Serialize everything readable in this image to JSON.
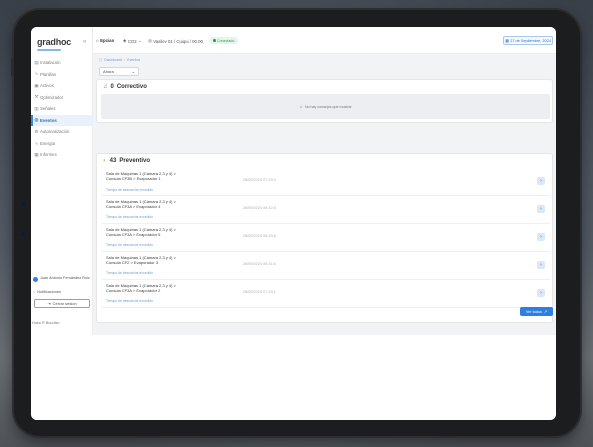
{
  "app": {
    "logo_text": "gradhoc",
    "topbar": {
      "project": "Epcian",
      "site": "CO2",
      "address": "Vasilev 01 / Cuiqui / 00.00",
      "status": "Conectado",
      "date": "27 de Septiembre, 2024"
    },
    "sidebar": {
      "items": [
        {
          "label": "Instalación",
          "icon": "chart-icon",
          "active": false
        },
        {
          "label": "Planillas",
          "icon": "pulse-icon",
          "active": false
        },
        {
          "label": "Activos",
          "icon": "box-icon",
          "active": false
        },
        {
          "label": "Optimizador",
          "icon": "wrench-icon",
          "active": false
        },
        {
          "label": "Señales",
          "icon": "signal-icon",
          "active": false
        },
        {
          "label": "Eventos",
          "icon": "alert-icon",
          "active": true
        },
        {
          "label": "Automatización",
          "icon": "gear-icon",
          "active": false
        },
        {
          "label": "Energía",
          "icon": "bolt-icon",
          "active": false
        },
        {
          "label": "Informes",
          "icon": "doc-icon",
          "active": false
        }
      ],
      "user": "Juan Antonio Fernández Ruiz",
      "notifications": "Notificaciones",
      "logout": "Cerrar sesión",
      "footer": "Hoko ® Bourilso"
    },
    "breadcrumb": [
      "Dashboard",
      "Eventos"
    ],
    "filter_select": "Ahora",
    "correctivo": {
      "count": "0",
      "title": "Correctivo",
      "empty_message": "No hay consejos que mostrar"
    },
    "preventivo": {
      "count": "43",
      "title": "Preventivo",
      "rows": [
        {
          "title": "Sala de Maquinas 1 (Cámara 2,3 y 4) > Consola CF3B > Evaporador 1",
          "sub": "Tiempo de descarche excedido",
          "date": "28/09/2024 07:29:3"
        },
        {
          "title": "Sala de Maquinas 1 (Cámara 2,3 y 4) > Consola CF3A > Evaporador 4",
          "sub": "Tiempo de descarche excedido",
          "date": "28/09/2024 06:42:5"
        },
        {
          "title": "Sala de Maquinas 1 (Cámara 2,3 y 4) > Consola CF3A > Evaporador 5",
          "sub": "Tiempo de descarche excedido",
          "date": "28/09/2024 06:33:6"
        },
        {
          "title": "Sala de Maquinas 1 (Cámara 2,3 y 4) > Consola CF2 > Evaporador 3",
          "sub": "Tiempo de descarche excedido",
          "date": "28/09/2024 06:31:6"
        },
        {
          "title": "Sala de Maquinas 1 (Cámara 2,3 y 4) > Consola CF3A > Evaporador 2",
          "sub": "Tiempo de descarche excedido",
          "date": "28/09/2024 07:19:1"
        }
      ],
      "view_all": "Ver todos"
    }
  }
}
